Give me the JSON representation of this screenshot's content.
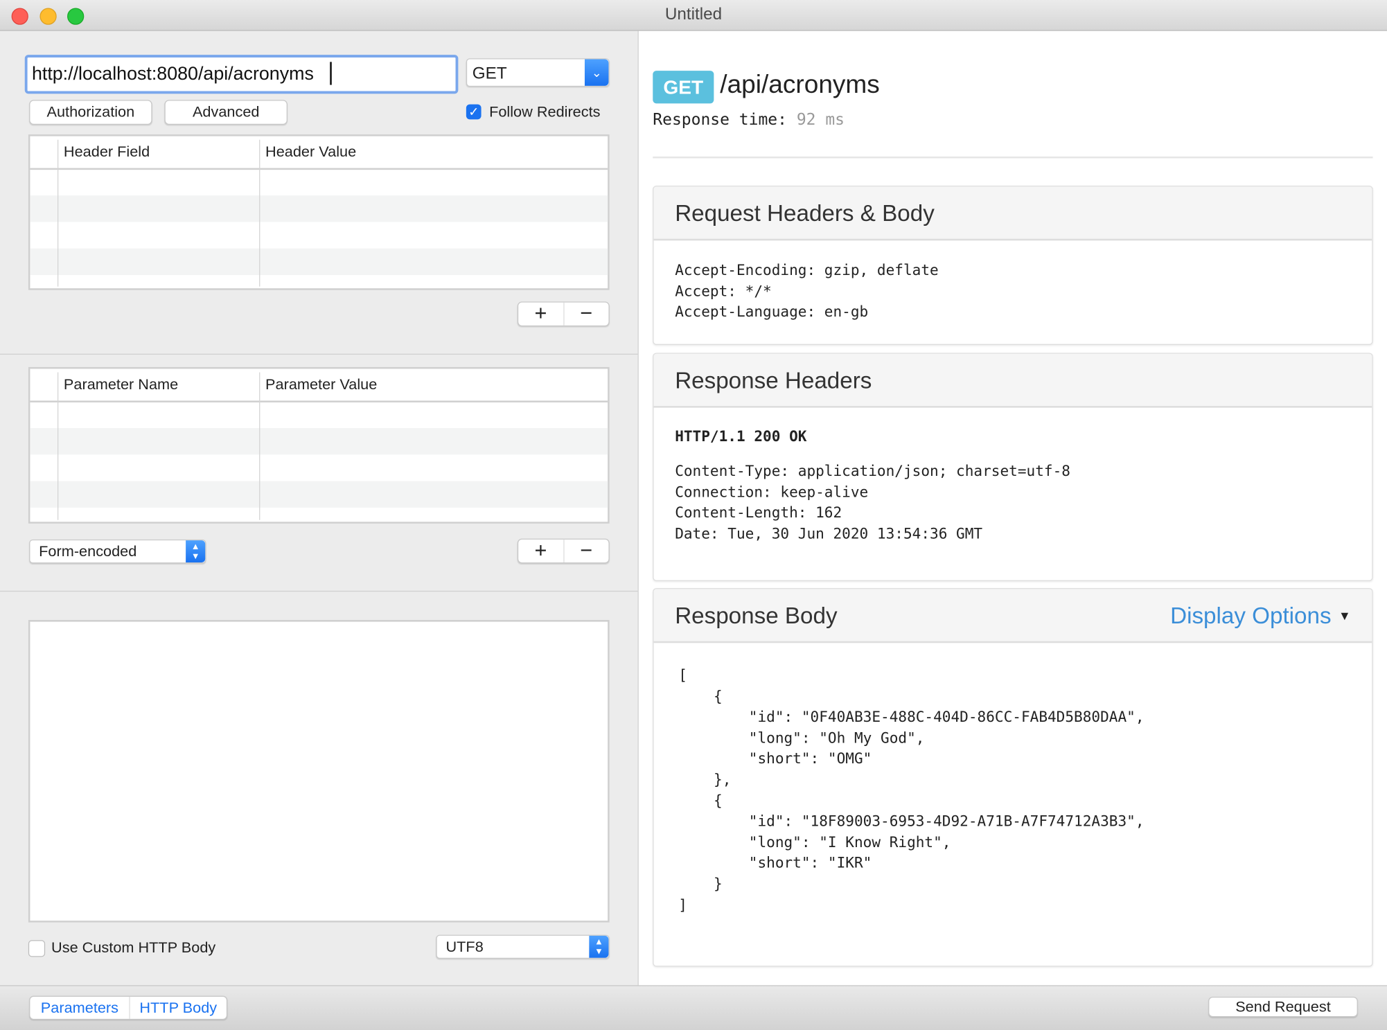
{
  "window": {
    "title": "Untitled"
  },
  "request": {
    "url": "http://localhost:8080/api/acronyms",
    "method": "GET",
    "authorization_label": "Authorization",
    "advanced_label": "Advanced",
    "follow_redirects_label": "Follow Redirects",
    "follow_redirects_checked": true,
    "headers_table": {
      "columns": [
        "Header Field",
        "Header Value"
      ],
      "rows": []
    },
    "parameters_table": {
      "columns": [
        "Parameter Name",
        "Parameter Value"
      ],
      "rows": []
    },
    "add_label": "+",
    "remove_label": "−",
    "encoding_select": "Form-encoded",
    "body_text": "",
    "use_custom_body_label": "Use Custom HTTP Body",
    "use_custom_body_checked": false,
    "charset_select": "UTF8"
  },
  "bottom": {
    "tabs": [
      "Parameters",
      "HTTP Body"
    ],
    "send_label": "Send Request"
  },
  "response": {
    "method_badge": "GET",
    "path": "/api/acronyms",
    "time_label": "Response time:",
    "time_value": "92 ms",
    "request_panel": {
      "title": "Request Headers & Body",
      "lines": [
        "Accept-Encoding: gzip, deflate",
        "Accept: */*",
        "Accept-Language: en-gb"
      ]
    },
    "headers_panel": {
      "title": "Response Headers",
      "status": "HTTP/1.1 200 OK",
      "lines": [
        "Content-Type: application/json; charset=utf-8",
        "Connection: keep-alive",
        "Content-Length: 162",
        "Date: Tue, 30 Jun 2020 13:54:36 GMT"
      ]
    },
    "body_panel": {
      "title": "Response Body",
      "display_options": "Display Options",
      "body": "[\n    {\n        \"id\": \"0F40AB3E-488C-404D-86CC-FAB4D5B80DAA\",\n        \"long\": \"Oh My God\",\n        \"short\": \"OMG\"\n    },\n    {\n        \"id\": \"18F89003-6953-4D92-A71B-A7F74712A3B3\",\n        \"long\": \"I Know Right\",\n        \"short\": \"IKR\"\n    }\n]"
    }
  },
  "colors": {
    "accent": "#1a72f0",
    "badge": "#5bc0de",
    "link": "#3b8ed8"
  }
}
